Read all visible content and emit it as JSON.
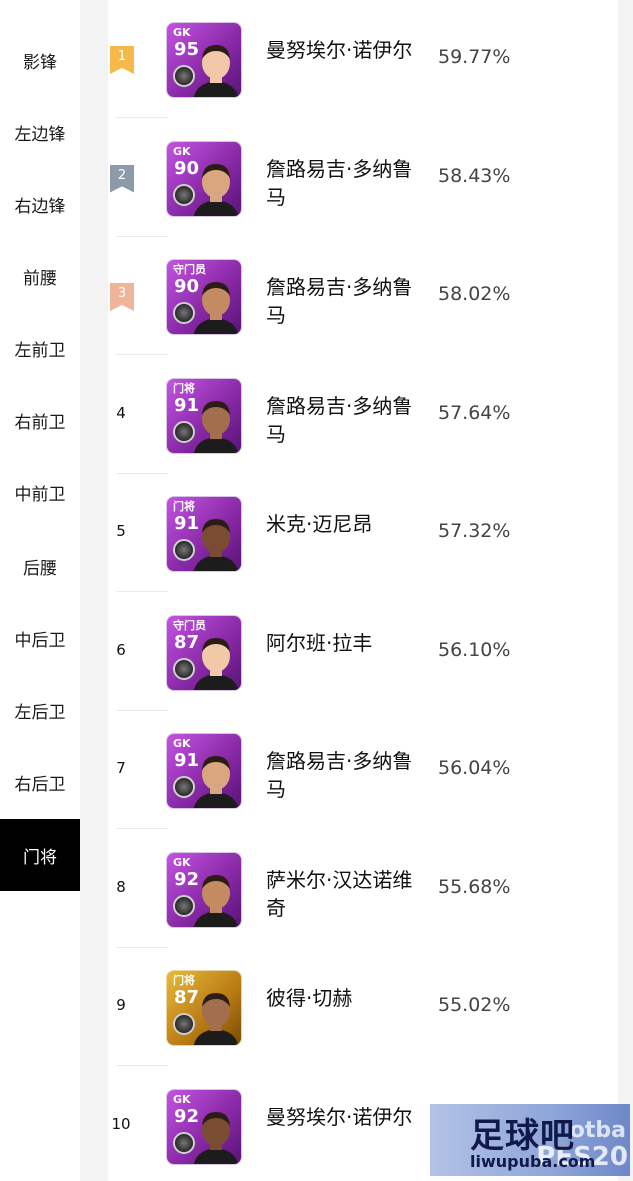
{
  "sidebar": {
    "items": [
      {
        "label": "影锋"
      },
      {
        "label": "左边锋"
      },
      {
        "label": "右边锋"
      },
      {
        "label": "前腰"
      },
      {
        "label": "左前卫"
      },
      {
        "label": "右前卫"
      },
      {
        "label": "中前卫"
      },
      {
        "label": "后腰"
      },
      {
        "label": "中后卫"
      },
      {
        "label": "左后卫"
      },
      {
        "label": "右后卫"
      },
      {
        "label": "门将"
      }
    ],
    "active": "门将"
  },
  "colors": {
    "rank1": "#f6b84a",
    "rank2": "#8e99a9",
    "rank3": "#f0b49a",
    "card_purple": "#9b33c0",
    "card_gold": "#c98e1e"
  },
  "rows": [
    {
      "rank": "1",
      "pos": "GK",
      "ovr": "95",
      "name": "曼努埃尔·诺伊尔",
      "pct": "59.77%",
      "card": "purple"
    },
    {
      "rank": "2",
      "pos": "GK",
      "ovr": "90",
      "name": "詹路易吉·多纳鲁马",
      "pct": "58.43%",
      "card": "purple"
    },
    {
      "rank": "3",
      "pos": "守门员",
      "ovr": "90",
      "name": "詹路易吉·多纳鲁马",
      "pct": "58.02%",
      "card": "purple"
    },
    {
      "rank": "4",
      "pos": "门将",
      "ovr": "91",
      "name": "詹路易吉·多纳鲁马",
      "pct": "57.64%",
      "card": "purple"
    },
    {
      "rank": "5",
      "pos": "门将",
      "ovr": "91",
      "name": "米克·迈尼昂",
      "pct": "57.32%",
      "card": "purple"
    },
    {
      "rank": "6",
      "pos": "守门员",
      "ovr": "87",
      "name": "阿尔班·拉丰",
      "pct": "56.10%",
      "card": "purple"
    },
    {
      "rank": "7",
      "pos": "GK",
      "ovr": "91",
      "name": "詹路易吉·多纳鲁马",
      "pct": "56.04%",
      "card": "purple"
    },
    {
      "rank": "8",
      "pos": "GK",
      "ovr": "92",
      "name": "萨米尔·汉达诺维奇",
      "pct": "55.68%",
      "card": "purple"
    },
    {
      "rank": "9",
      "pos": "门将",
      "ovr": "87",
      "name": "彼得·切赫",
      "pct": "55.02%",
      "card": "gold"
    },
    {
      "rank": "10",
      "pos": "GK",
      "ovr": "92",
      "name": "曼努埃尔·诺伊尔",
      "pct": "",
      "card": "purple"
    }
  ],
  "watermark": {
    "title": "足球吧",
    "url": "liwupuba.com",
    "bg_text": "otba",
    "pes_text": "PES20"
  }
}
